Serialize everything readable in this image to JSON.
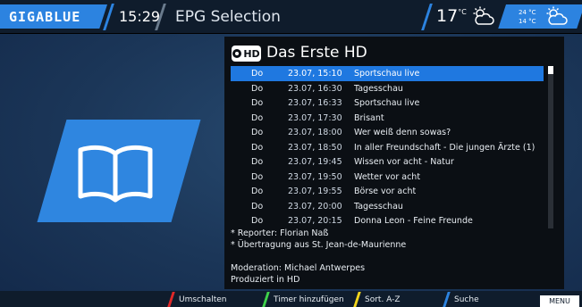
{
  "header": {
    "brand": "GIGABLUE",
    "time": "15:29",
    "title": "EPG Selection",
    "temperature": "17",
    "temperature_unit": "°C",
    "forecast_high": "24 °C",
    "forecast_low": "14 °C",
    "weather_icon": "partly-cloudy-sun-icon",
    "accent_color": "#2c83e0"
  },
  "channel": {
    "logo_text": "HD",
    "name": "Das Erste HD"
  },
  "events": [
    {
      "day": "Do",
      "datetime": "23.07, 15:10",
      "title": "Sportschau live",
      "selected": true
    },
    {
      "day": "Do",
      "datetime": "23.07, 16:30",
      "title": "Tagesschau"
    },
    {
      "day": "Do",
      "datetime": "23.07, 16:33",
      "title": "Sportschau live"
    },
    {
      "day": "Do",
      "datetime": "23.07, 17:30",
      "title": "Brisant"
    },
    {
      "day": "Do",
      "datetime": "23.07, 18:00",
      "title": "Wer weiß denn sowas?"
    },
    {
      "day": "Do",
      "datetime": "23.07, 18:50",
      "title": "In aller Freundschaft - Die jungen Ärzte (1)"
    },
    {
      "day": "Do",
      "datetime": "23.07, 19:45",
      "title": "Wissen vor acht - Natur"
    },
    {
      "day": "Do",
      "datetime": "23.07, 19:50",
      "title": "Wetter vor acht"
    },
    {
      "day": "Do",
      "datetime": "23.07, 19:55",
      "title": "Börse vor acht"
    },
    {
      "day": "Do",
      "datetime": "23.07, 20:00",
      "title": "Tagesschau"
    },
    {
      "day": "Do",
      "datetime": "23.07, 20:15",
      "title": "Donna Leon - Feine Freunde"
    }
  ],
  "description": {
    "line1": "* Reporter: Florian Naß",
    "line2": "* Übertragung aus St. Jean-de-Maurienne",
    "line3": "Moderation: Michael Antwerpes",
    "line4": "Produziert in HD"
  },
  "footer": {
    "red": "Umschalten",
    "green": "Timer hinzufügen",
    "yellow": "Sort. A-Z",
    "blue": "Suche",
    "menu": "MENU",
    "colors": {
      "red": "#e02828",
      "green": "#3fd14a",
      "yellow": "#f2d51c",
      "blue": "#2c83e0"
    }
  }
}
